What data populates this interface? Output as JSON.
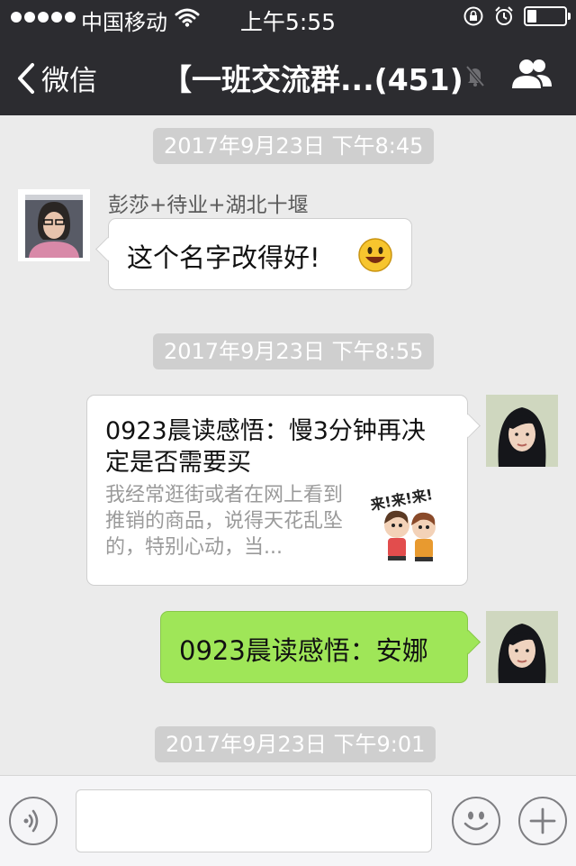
{
  "status_bar": {
    "carrier": "中国移动",
    "time": "上午5:55",
    "battery_level": 0.25
  },
  "nav": {
    "back_label": "微信",
    "title": "【一班交流群...(451)"
  },
  "messages": {
    "ts1": "2017年9月23日 下午8:45",
    "m1": {
      "sender": "彭莎+待业+湖北十堰",
      "text": "这个名字改得好!"
    },
    "ts2": "2017年9月23日 下午8:55",
    "m2": {
      "title": "0923晨读感悟：慢3分钟再决定是否需要买",
      "desc": "我经常逛街或者在网上看到推销的商品，说得天花乱坠的，特别心动，当...",
      "thumb_text": "来!来!来!"
    },
    "m3": {
      "text": "0923晨读感悟：安娜"
    },
    "ts3": "2017年9月23日 下午9:01"
  },
  "input_bar": {
    "placeholder": ""
  }
}
